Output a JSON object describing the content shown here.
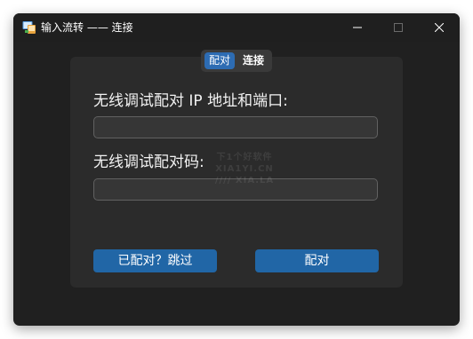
{
  "window": {
    "title": "输入流转 —— 连接"
  },
  "tabs": {
    "pair_label": "配对",
    "connect_label": "连接",
    "active": "pair"
  },
  "form": {
    "ip_label": "无线调试配对 IP 地址和端口:",
    "ip_value": "",
    "code_label": "无线调试配对码:",
    "code_value": ""
  },
  "watermark": {
    "line1": "下1个好软件",
    "line2": "XIA1YI.CN",
    "line3": "//// XIA.LA"
  },
  "buttons": {
    "skip_label": "已配对？跳过",
    "pair_label": "配对"
  },
  "colors": {
    "accent": "#2166a6",
    "window_bg": "#202020",
    "card_bg": "#2b2b2b"
  }
}
